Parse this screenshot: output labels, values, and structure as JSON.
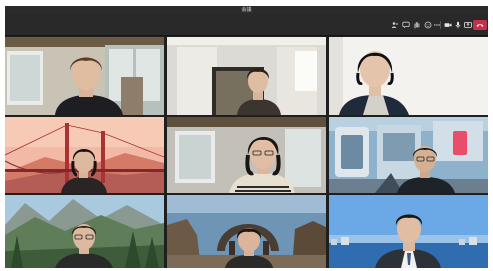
{
  "window": {
    "title": "会議"
  },
  "toolbar": {
    "icons": [
      "people-icon",
      "chat-icon",
      "raise-hand-icon",
      "reactions-icon",
      "more-icon",
      "camera-icon",
      "mic-icon",
      "share-icon",
      "leave-call-icon"
    ]
  },
  "tiles": [
    {
      "label": ""
    },
    {
      "label": ""
    },
    {
      "label": ""
    },
    {
      "label": ""
    },
    {
      "label": ""
    },
    {
      "label": ""
    },
    {
      "label": ""
    },
    {
      "label": ""
    },
    {
      "label": ""
    }
  ],
  "colors": {
    "leave_button": "#c4314b",
    "toolbar_bg": "#292929",
    "window_bg": "#1f1f1f"
  }
}
